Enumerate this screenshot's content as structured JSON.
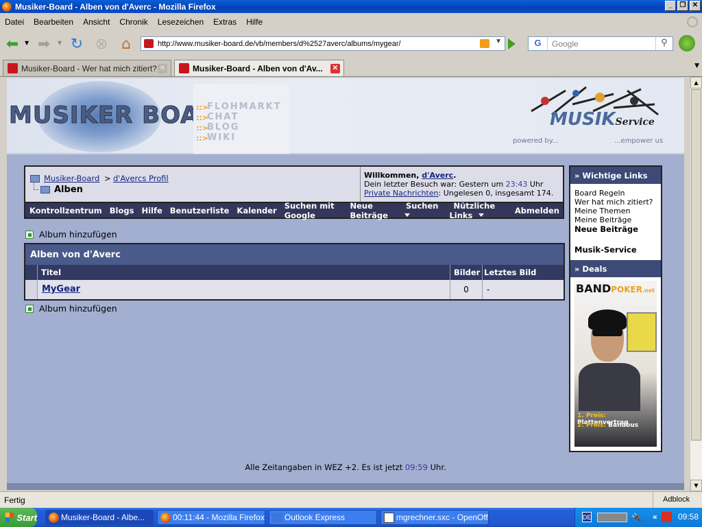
{
  "window": {
    "title": "Musiker-Board - Alben von d'Averc - Mozilla Firefox"
  },
  "menubar": [
    "Datei",
    "Bearbeiten",
    "Ansicht",
    "Chronik",
    "Lesezeichen",
    "Extras",
    "Hilfe"
  ],
  "navbar": {
    "url": "http://www.musiker-board.de/vb/members/d%2527averc/albums/mygear/",
    "search_placeholder": "Google",
    "search_engine": "G"
  },
  "tabs": [
    {
      "label": "Musiker-Board - Wer hat mich zitiert?",
      "active": false
    },
    {
      "label": "Musiker-Board - Alben von d'Av...",
      "active": true
    }
  ],
  "banner": {
    "logo_text": "MUSIKER BOARD",
    "links": [
      "FLOHMARKT",
      "CHAT",
      "BLOG",
      "WIKI"
    ],
    "partner_logo": "MUSIK",
    "partner_logo_script": "Service",
    "powered_by": "powered by...",
    "empower_us": "...empower us"
  },
  "breadcrumb": {
    "root": "Musiker-Board",
    "separator": ">",
    "profile": "d'Avercs Profil",
    "current": "Alben"
  },
  "welcome": {
    "greeting": "Willkommen, ",
    "user": "d'Averc",
    "period": ".",
    "last_visit_prefix": "Dein letzter Besuch war: Gestern um ",
    "last_visit_time": "23:43",
    "last_visit_suffix": " Uhr",
    "pm_link": "Private Nachrichten",
    "pm_stats": ": Ungelesen 0, insgesamt 174."
  },
  "nav": [
    "Kontrollzentrum",
    "Blogs",
    "Hilfe",
    "Benutzerliste",
    "Kalender",
    "Suchen mit Google",
    "Neue Beiträge",
    "Suchen",
    "Nützliche Links",
    "Abmelden"
  ],
  "album": {
    "add_label": "Album hinzufügen",
    "table_title": "Alben von d'Averc",
    "columns": [
      "Titel",
      "Bilder",
      "Letztes Bild"
    ],
    "rows": [
      {
        "title": "MyGear",
        "count": "0",
        "last": "-"
      }
    ]
  },
  "sidebar": {
    "important_title": "» Wichtige Links",
    "links": [
      "Board Regeln",
      "Wer hat mich zitiert?",
      "Meine Themen",
      "Meine Beiträge"
    ],
    "bold_link": "Neue Beiträge",
    "service_link": "Musik-Service",
    "deals_title": "» Deals",
    "ad": {
      "logo_band": "BAND",
      "logo_poker": "POKER",
      "logo_net": ".net",
      "prize1_label": "1. Preis:",
      "prize1": " Plattenvertrag",
      "prize2_label": "2. Preis:",
      "prize2": " Bandbus"
    }
  },
  "footer": {
    "prefix": "Alle Zeitangaben in WEZ +2. Es ist jetzt ",
    "time": "09:59",
    "suffix": " Uhr."
  },
  "statusbar": {
    "text": "Fertig",
    "adblock": "Adblock"
  },
  "taskbar": {
    "start": "Start",
    "items": [
      "Musiker-Board - Albe...",
      "00:11:44 - Mozilla Firefox",
      "Outlook Express",
      "mgrechner.sxc - OpenOffi..."
    ],
    "lang": "DE",
    "clock": "09:58"
  },
  "colors": {
    "accent": "#3d4a77",
    "link": "#14247c",
    "page_bg": "#a2afd0"
  }
}
